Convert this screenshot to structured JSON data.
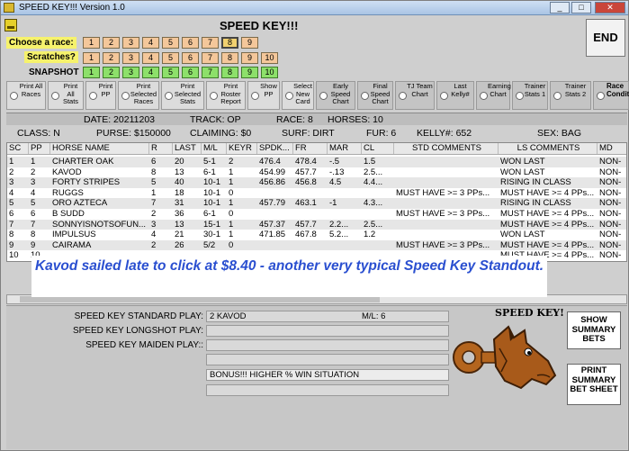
{
  "window": {
    "title": "SPEED KEY!!!   Version 1.0",
    "close_label": "✕"
  },
  "app_title": "SPEED KEY!!!",
  "end_label": "END",
  "labels": {
    "race": "Choose a race:",
    "scratches": "Scratches?",
    "snapshot": "SNAPSHOT"
  },
  "race_numbers": [
    "1",
    "2",
    "3",
    "4",
    "5",
    "6",
    "7",
    "8",
    "9"
  ],
  "selected_race": "8",
  "scratch_numbers": [
    "1",
    "2",
    "3",
    "4",
    "5",
    "6",
    "7",
    "8",
    "9",
    "10"
  ],
  "snapshot_numbers": [
    "1",
    "2",
    "3",
    "4",
    "5",
    "6",
    "7",
    "8",
    "9",
    "10"
  ],
  "options": [
    "Print All Races",
    "Print All Stats",
    "Print PP",
    "Print Selected Races",
    "Print Selected Stats",
    "Print Roster Report",
    "Show PP",
    "Select New Card",
    "Early Speed Chart",
    "Final Speed Chart",
    "TJ Team Chart",
    "Last Kelly#",
    "Earning Chart",
    "Trainer Stats 1",
    "Trainer Stats 2",
    "Race Conditions"
  ],
  "info": {
    "date": "DATE: 20211203",
    "track": "TRACK: OP",
    "race": "RACE: 8",
    "horses": "HORSES: 10",
    "class": "CLASS: N",
    "purse": "PURSE: $150000",
    "claiming": "CLAIMING: $0",
    "surf": "SURF: DIRT",
    "fur": "FUR: 6",
    "kelly": "KELLY#: 652",
    "sex": "SEX: BAG"
  },
  "grid": {
    "headers": [
      "SC",
      "PP",
      "HORSE NAME",
      "R",
      "LAST",
      "M/L",
      "KEYR",
      "SPDK...",
      "FR",
      "MAR",
      "CL",
      "STD COMMENTS",
      "LS COMMENTS",
      "MD"
    ],
    "rows": [
      [
        "1",
        "1",
        "CHARTER OAK",
        "6",
        "20",
        "5-1",
        "2",
        "476.4",
        "478.4",
        "-.5",
        "1.5",
        "",
        "WON LAST",
        "NON-"
      ],
      [
        "2",
        "2",
        "KAVOD",
        "8",
        "13",
        "6-1",
        "1",
        "454.99",
        "457.7",
        "-.13",
        "2.5...",
        "",
        "WON LAST",
        "NON-"
      ],
      [
        "3",
        "3",
        "FORTY STRIPES",
        "5",
        "40",
        "10-1",
        "1",
        "456.86",
        "456.8",
        "4.5",
        "4.4...",
        "",
        "RISING IN CLASS",
        "NON-"
      ],
      [
        "4",
        "4",
        "RUGGS",
        "1",
        "18",
        "10-1",
        "0",
        "",
        "",
        "",
        "",
        "MUST HAVE >= 3 PPs...",
        "MUST HAVE >= 4 PPs...",
        "NON-"
      ],
      [
        "5",
        "5",
        "ORO AZTECA",
        "7",
        "31",
        "10-1",
        "1",
        "457.79",
        "463.1",
        "-1",
        "4.3...",
        "",
        "RISING IN CLASS",
        "NON-"
      ],
      [
        "6",
        "6",
        "B SUDD",
        "2",
        "36",
        "6-1",
        "0",
        "",
        "",
        "",
        "",
        "MUST HAVE >= 3 PPs...",
        "MUST HAVE >= 4 PPs...",
        "NON-"
      ],
      [
        "7",
        "7",
        "SONNYISNOTSOFUN...",
        "3",
        "13",
        "15-1",
        "1",
        "457.37",
        "457.7",
        "2.2...",
        "2.5...",
        "",
        "MUST HAVE >= 4 PPs...",
        "NON-"
      ],
      [
        "8",
        "8",
        "IMPULSUS",
        "4",
        "21",
        "30-1",
        "1",
        "471.85",
        "467.8",
        "5.2...",
        "1.2",
        "",
        "WON LAST",
        "NON-"
      ],
      [
        "9",
        "9",
        "CAIRAMA",
        "2",
        "26",
        "5/2",
        "0",
        "",
        "",
        "",
        "",
        "MUST HAVE >= 3 PPs...",
        "MUST HAVE >= 4 PPs...",
        "NON-"
      ],
      [
        "10",
        "10",
        "",
        "",
        "",
        "",
        "",
        "",
        "",
        "",
        "",
        "",
        "MUST HAVE >= 4 PPs...",
        "NON-"
      ]
    ]
  },
  "overlay_text": "Kavod sailed late to click at $8.40 - another very typical Speed Key Standout.",
  "plays": {
    "standard_label": "SPEED KEY STANDARD PLAY:",
    "standard_value": "2  KAVOD",
    "standard_ml": "M/L:  6",
    "longshot_label": "SPEED KEY LONGSHOT PLAY:",
    "maiden_label": "SPEED KEY MAIDEN PLAY::",
    "bonus_text": "BONUS!!! HIGHER % WIN SITUATION"
  },
  "logo_title": "SPEED KEY!",
  "show_summary_label": "SHOW SUMMARY BETS",
  "print_summary_label": "PRINT SUMMARY BET SHEET",
  "colors": {
    "accent_yellow": "#f6f26c",
    "race_button": "#f4c79a",
    "snapshot_button": "#8de06a",
    "overlay_text": "#2a4fd0"
  }
}
